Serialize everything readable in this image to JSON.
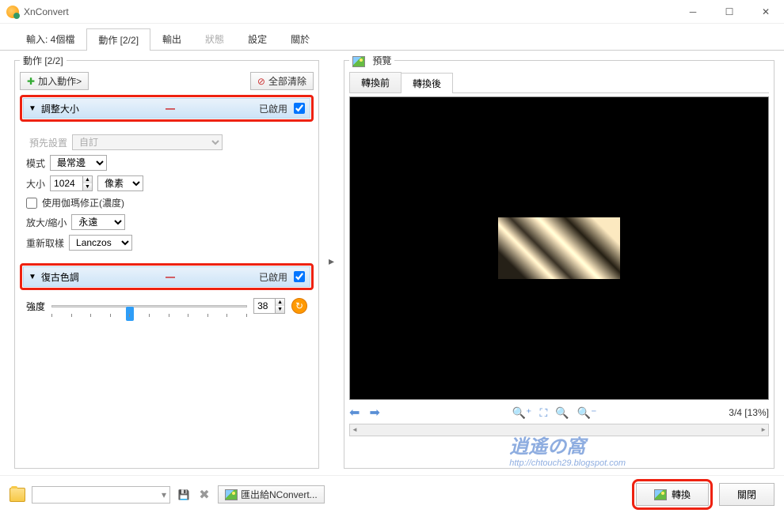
{
  "window": {
    "title": "XnConvert"
  },
  "mainTabs": [
    {
      "label": "輸入: 4個檔",
      "active": false
    },
    {
      "label": "動作 [2/2]",
      "active": true
    },
    {
      "label": "輸出",
      "active": false
    },
    {
      "label": "狀態",
      "disabled": true
    },
    {
      "label": "設定",
      "active": false
    },
    {
      "label": "關於",
      "active": false
    }
  ],
  "actions": {
    "legend": "動作 [2/2]",
    "addBtn": "加入動作>",
    "clearBtn": "全部清除",
    "items": [
      {
        "title": "調整大小",
        "enableLabel": "已啟用",
        "enabled": true,
        "preset": {
          "label": "預先設置",
          "value": "自訂"
        },
        "mode": {
          "label": "模式",
          "value": "最常邊"
        },
        "size": {
          "label": "大小",
          "value": "1024",
          "unit": "像素"
        },
        "gamma": {
          "label": "使用伽瑪修正(濃度)",
          "checked": false
        },
        "scale": {
          "label": "放大/縮小",
          "value": "永遠"
        },
        "resample": {
          "label": "重新取樣",
          "value": "Lanczos"
        }
      },
      {
        "title": "復古色調",
        "enableLabel": "已啟用",
        "enabled": true,
        "intensity": {
          "label": "強度",
          "value": "38",
          "percent": 38
        }
      }
    ]
  },
  "preview": {
    "legend": "預覽",
    "beforeTab": "轉換前",
    "afterTab": "轉換後",
    "status": "3/4 [13%]"
  },
  "bottom": {
    "exportBtn": "匯出給NConvert...",
    "convertBtn": "轉換",
    "closeBtn": "關閉"
  },
  "watermark": {
    "logo": "逍遙の窩",
    "url": "http://chtouch29.blogspot.com"
  }
}
